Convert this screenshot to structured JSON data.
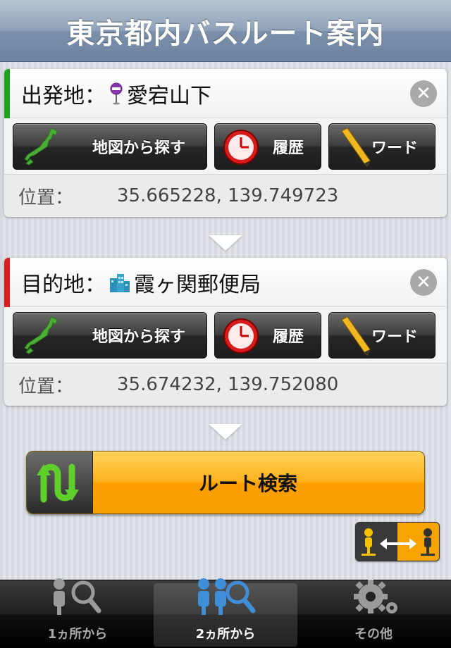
{
  "header": {
    "title": "東京都内バスルート案内"
  },
  "origin": {
    "label": "出発地：",
    "place": "愛宕山下",
    "place_icon": "bus-stop-icon",
    "stripe_color": "#1fa21f",
    "buttons": {
      "map": "地図から探す",
      "history": "履歴",
      "word": "ワード"
    },
    "position_label": "位置：",
    "position_value": "35.665228, 139.749723"
  },
  "destination": {
    "label": "目的地：",
    "place": "霞ヶ関郵便局",
    "place_icon": "building-icon",
    "stripe_color": "#d92020",
    "buttons": {
      "map": "地図から探す",
      "history": "履歴",
      "word": "ワード"
    },
    "position_label": "位置：",
    "position_value": "35.674232, 139.752080"
  },
  "route_search": {
    "label": "ルート検索",
    "accent": "#ffb21d"
  },
  "tabs": [
    {
      "label": "1ヵ所から",
      "active": false
    },
    {
      "label": "2ヵ所から",
      "active": true
    },
    {
      "label": "その他",
      "active": false
    }
  ]
}
